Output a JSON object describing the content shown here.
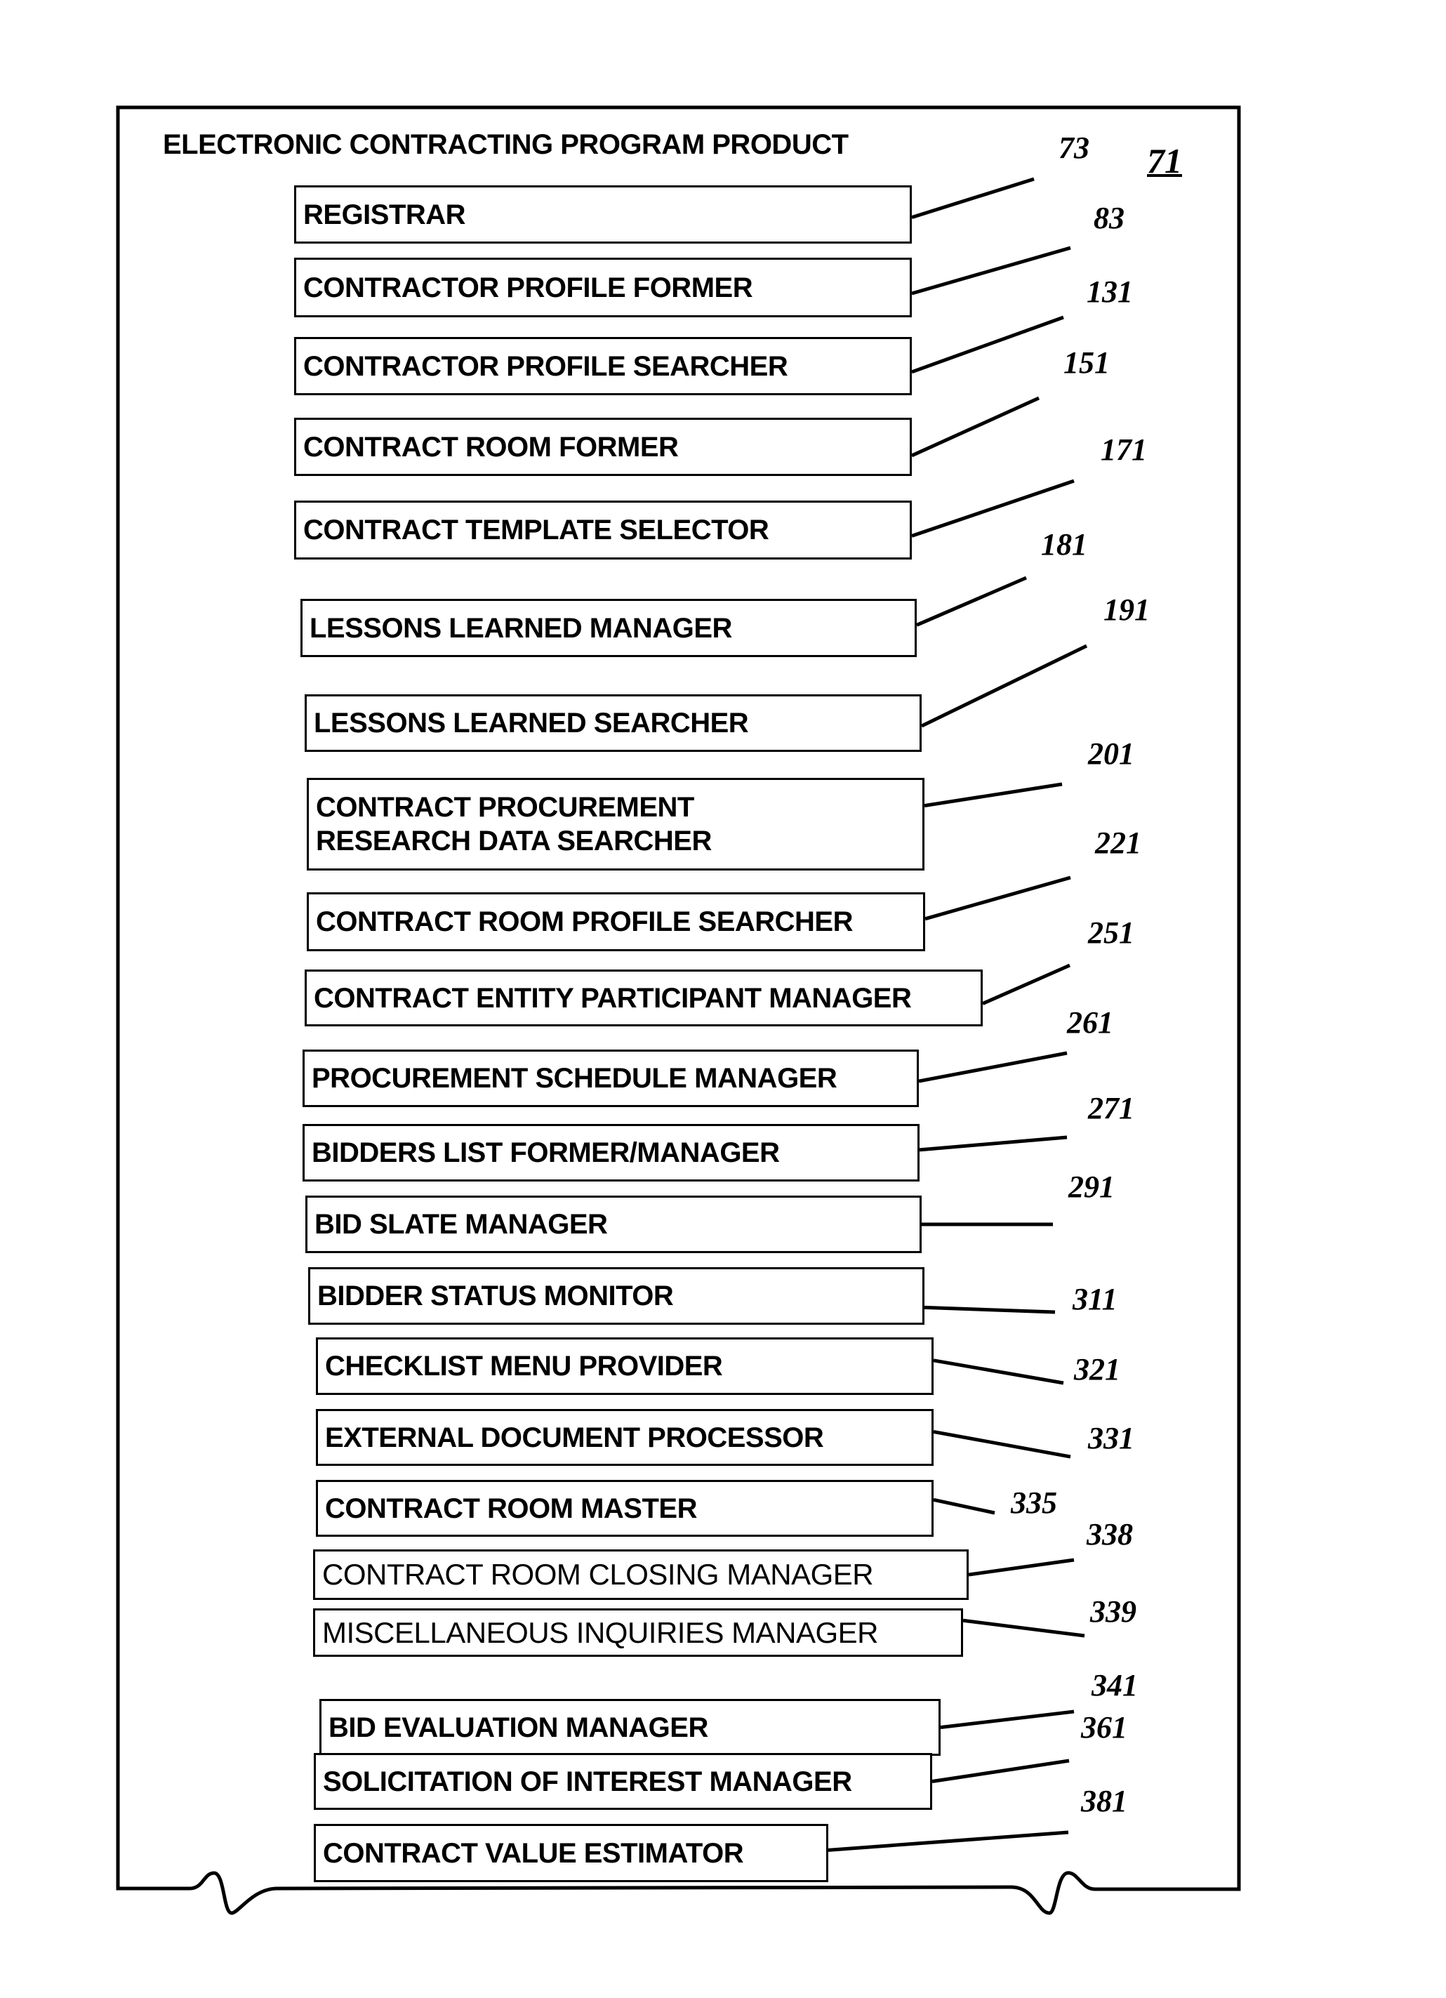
{
  "title": "ELECTRONIC CONTRACTING PROGRAM PRODUCT",
  "figure_ref": "71",
  "components": [
    {
      "label": "REGISTRAR",
      "ref": "73"
    },
    {
      "label": "CONTRACTOR PROFILE FORMER",
      "ref": "83"
    },
    {
      "label": "CONTRACTOR PROFILE SEARCHER",
      "ref": "131"
    },
    {
      "label": "CONTRACT ROOM FORMER",
      "ref": "151"
    },
    {
      "label": "CONTRACT TEMPLATE SELECTOR",
      "ref": "171"
    },
    {
      "label": "LESSONS LEARNED MANAGER",
      "ref": "181"
    },
    {
      "label": "LESSONS LEARNED SEARCHER",
      "ref": "191"
    },
    {
      "label": "CONTRACT PROCUREMENT\nRESEARCH DATA SEARCHER",
      "ref": "201"
    },
    {
      "label": "CONTRACT ROOM PROFILE SEARCHER",
      "ref": "221"
    },
    {
      "label": "CONTRACT ENTITY PARTICIPANT MANAGER",
      "ref": "251"
    },
    {
      "label": "PROCUREMENT SCHEDULE MANAGER",
      "ref": "261"
    },
    {
      "label": "BIDDERS LIST FORMER/MANAGER",
      "ref": "271"
    },
    {
      "label": "BID SLATE MANAGER",
      "ref": "291"
    },
    {
      "label": "BIDDER STATUS MONITOR",
      "ref": "311"
    },
    {
      "label": "CHECKLIST MENU PROVIDER",
      "ref": "321"
    },
    {
      "label": "EXTERNAL DOCUMENT PROCESSOR",
      "ref": "331"
    },
    {
      "label": "CONTRACT ROOM MASTER",
      "ref": "335"
    },
    {
      "label": "CONTRACT ROOM CLOSING MANAGER",
      "ref": "338"
    },
    {
      "label": "MISCELLANEOUS INQUIRIES MANAGER",
      "ref": "339"
    },
    {
      "label": "BID EVALUATION MANAGER",
      "ref": "341"
    },
    {
      "label": "SOLICITATION OF INTEREST MANAGER",
      "ref": "361"
    },
    {
      "label": "CONTRACT VALUE ESTIMATOR",
      "ref": "381"
    }
  ]
}
